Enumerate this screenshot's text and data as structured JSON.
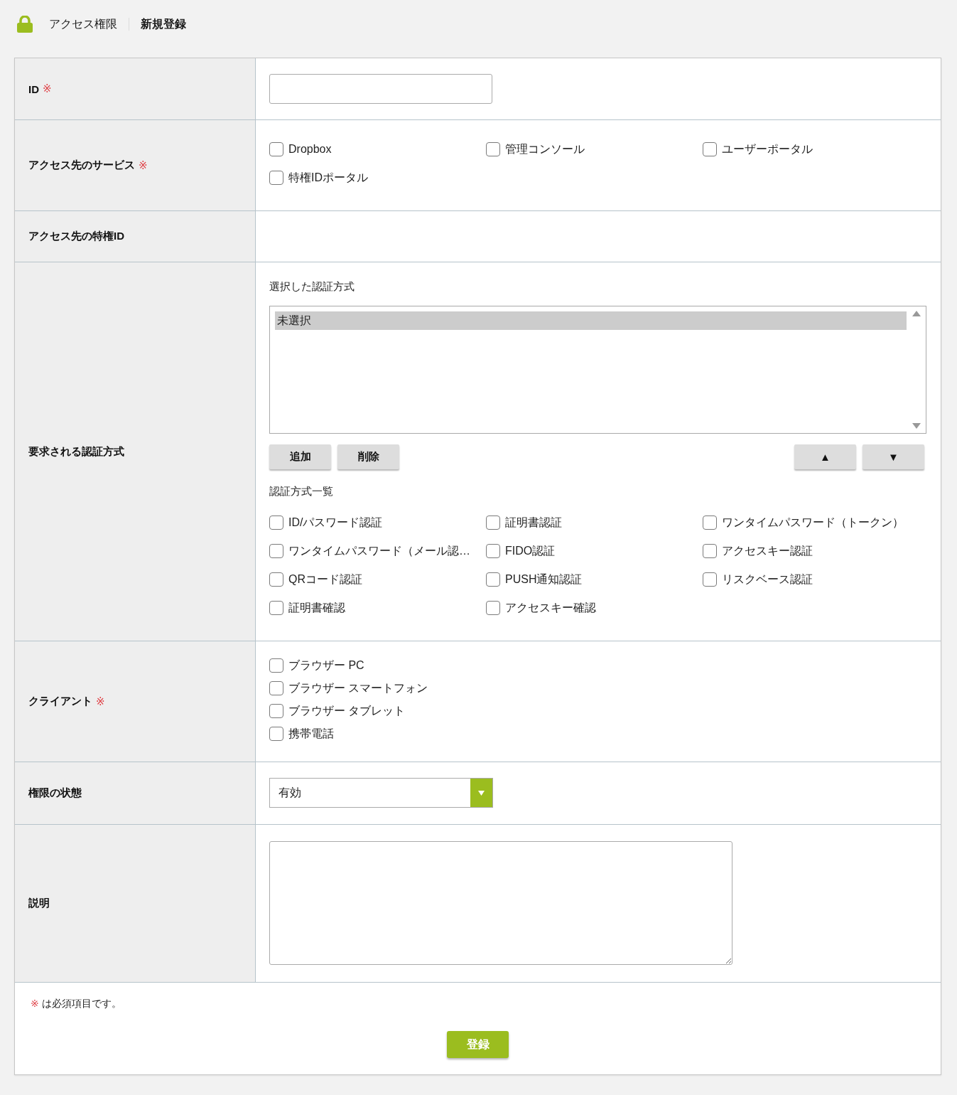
{
  "header": {
    "breadcrumb": [
      {
        "label": "アクセス権限"
      },
      {
        "label": "新規登録"
      }
    ]
  },
  "form": {
    "rows": [
      {
        "label": "ID",
        "mark": "※",
        "kind": "text_input"
      },
      {
        "label": "アクセス先のサービス",
        "mark": "※",
        "kind": "checkbox_grid",
        "options": [
          {
            "label": "Dropbox",
            "checked": false
          },
          {
            "label": "管理コンソール",
            "checked": false
          },
          {
            "label": "ユーザーポータル",
            "checked": false
          },
          {
            "label": "特権IDポータル",
            "checked": false
          }
        ]
      },
      {
        "label": "アクセス先の特権ID",
        "kind": "empty"
      },
      {
        "label": "要求される認証方式",
        "kind": "auth_methods",
        "selected_title": "選択した認証方式",
        "selected_list": [
          {
            "label": "未選択",
            "selected": true
          }
        ],
        "buttons": [
          {
            "label": "追加"
          },
          {
            "label": "削除"
          }
        ],
        "order_buttons": [
          {
            "label": "▲"
          },
          {
            "label": "▼"
          }
        ],
        "list_title": "認証方式一覧",
        "options": [
          {
            "label": "ID/パスワード認証",
            "checked": false
          },
          {
            "label": "証明書認証",
            "checked": false
          },
          {
            "label": "ワンタイムパスワード（トークン）",
            "checked": false
          },
          {
            "label": "ワンタイムパスワード（メール認…",
            "checked": false
          },
          {
            "label": "FIDO認証",
            "checked": false
          },
          {
            "label": "アクセスキー認証",
            "checked": false
          },
          {
            "label": "QRコード認証",
            "checked": false
          },
          {
            "label": "PUSH通知認証",
            "checked": false
          },
          {
            "label": "リスクベース認証",
            "checked": false
          },
          {
            "label": "証明書確認",
            "checked": false
          },
          {
            "label": "アクセスキー確認",
            "checked": false
          }
        ]
      },
      {
        "label": "クライアント",
        "mark": "※",
        "kind": "checkbox_list",
        "options": [
          {
            "label": "ブラウザー PC",
            "checked": false
          },
          {
            "label": "ブラウザー スマートフォン",
            "checked": false
          },
          {
            "label": "ブラウザー タブレット",
            "checked": false
          },
          {
            "label": "携帯電話",
            "checked": false
          }
        ]
      },
      {
        "label": "権限の状態",
        "kind": "select",
        "value": "有効"
      },
      {
        "label": "説明",
        "kind": "textarea"
      }
    ]
  },
  "footer": {
    "note": {
      "mark": "※",
      "text": "は必須項目です。"
    },
    "submit": "登録"
  }
}
